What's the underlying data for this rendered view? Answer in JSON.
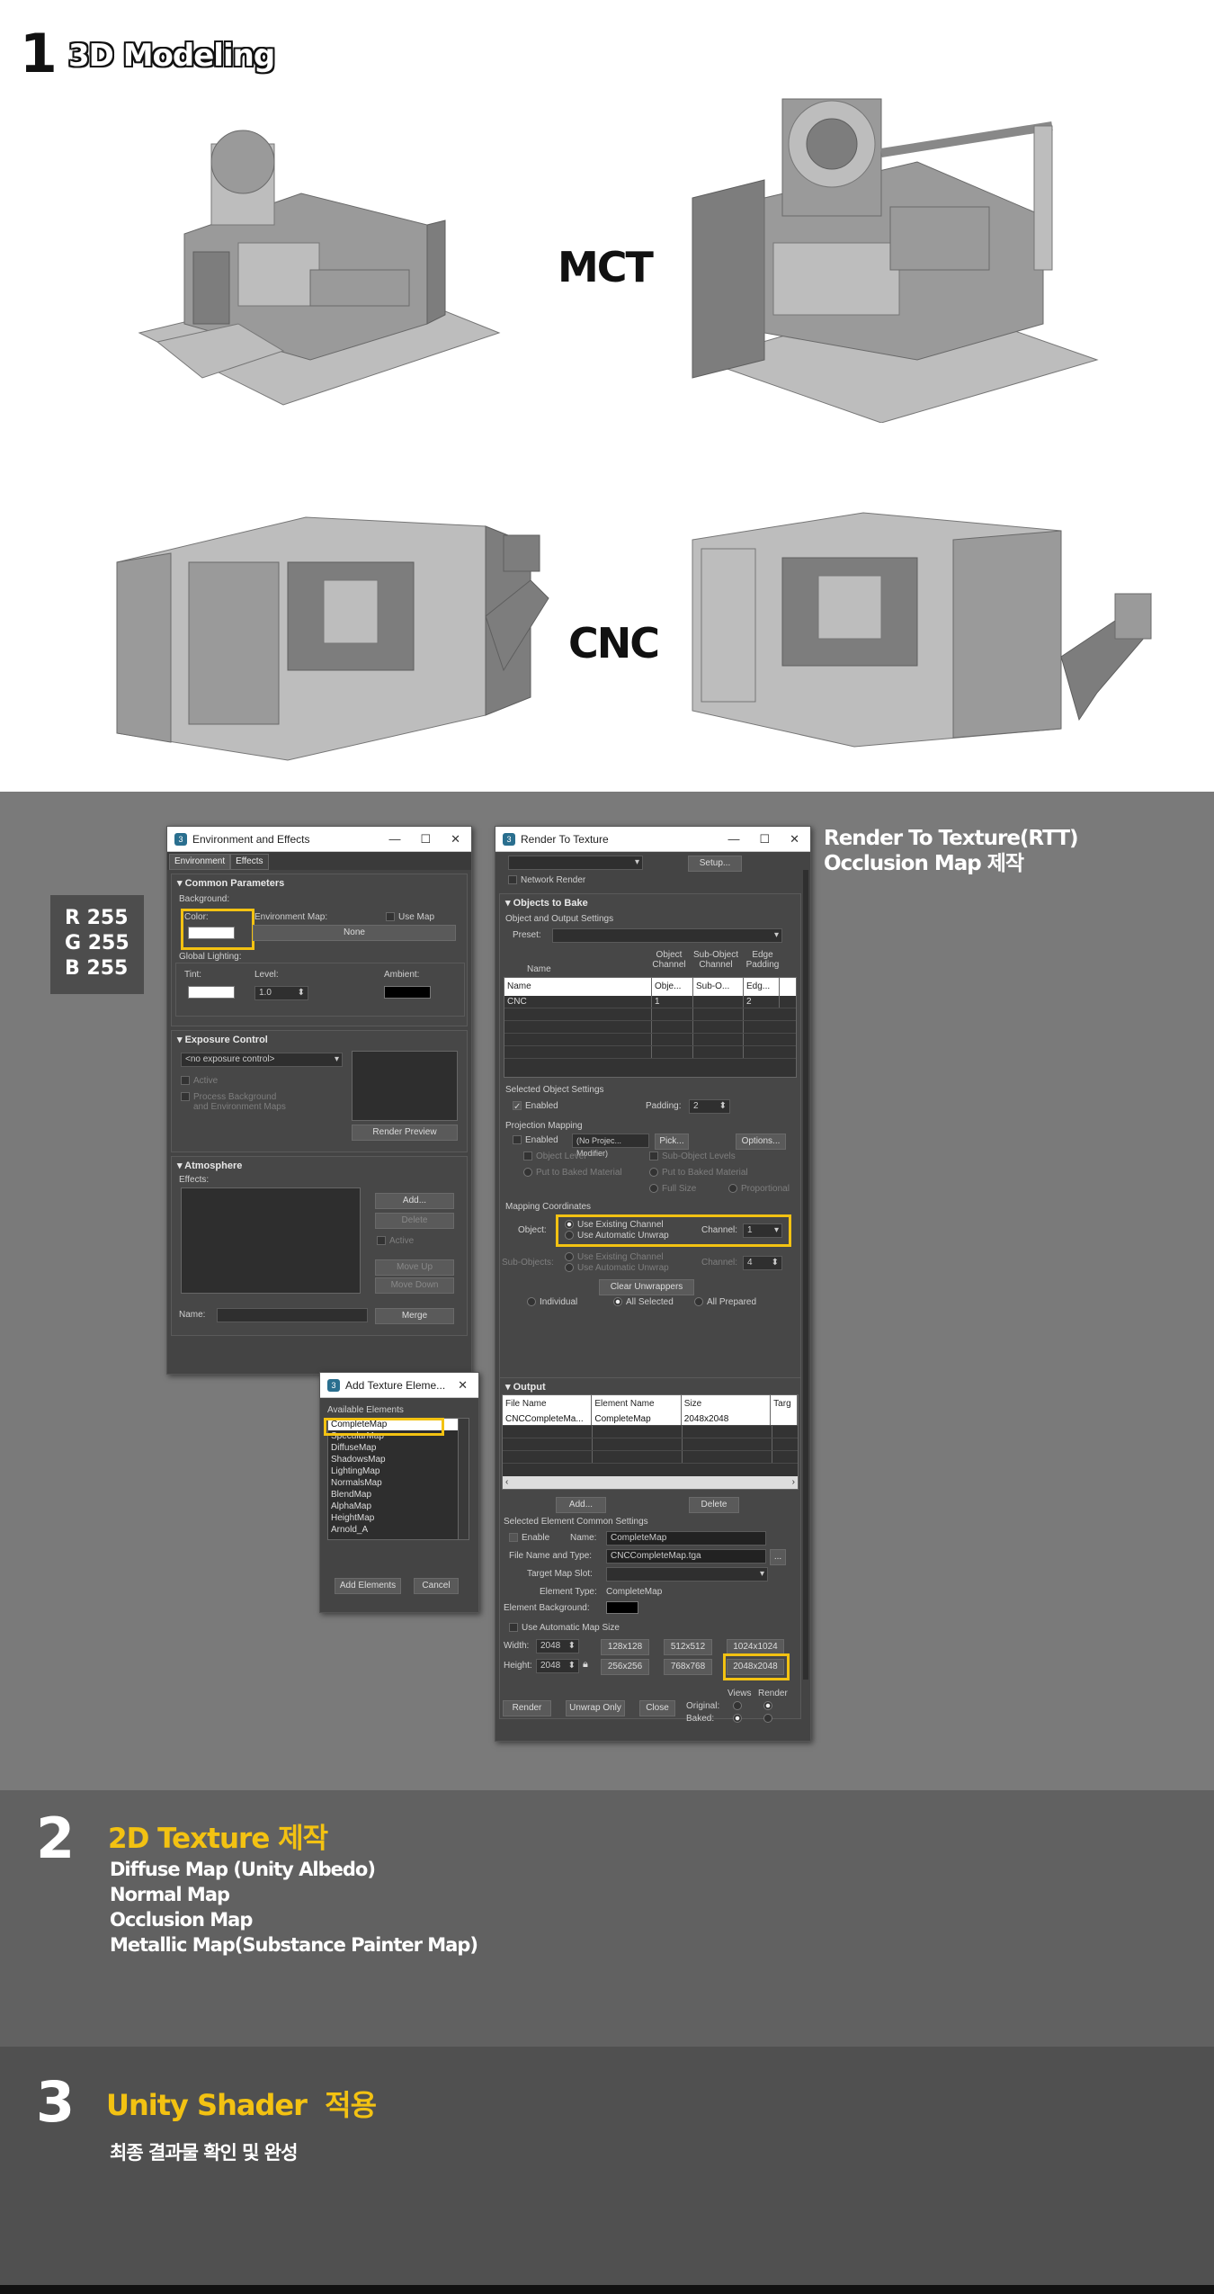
{
  "section1": {
    "number": "1",
    "title": "3D Modeling",
    "label_mct": "MCT",
    "label_cnc": "CNC"
  },
  "rgb_box": {
    "r": "R 255",
    "g": "G 255",
    "b": "B 255"
  },
  "rtt_caption": {
    "line1": "Render To Texture(RTT)",
    "line2": "Occlusion Map 제작"
  },
  "env_window": {
    "title": "Environment and Effects",
    "tabs": [
      "Environment",
      "Effects"
    ],
    "common_params": "Common Parameters",
    "background": "Background:",
    "color": "Color:",
    "env_map": "Environment Map:",
    "use_map": "Use Map",
    "none_btn": "None",
    "global_lighting": "Global Lighting:",
    "tint": "Tint:",
    "level": "Level:",
    "level_value": "1.0",
    "ambient": "Ambient:",
    "exposure_control": "Exposure Control",
    "no_exposure": "<no exposure control>",
    "active": "Active",
    "process_bg_1": "Process Background",
    "process_bg_2": "and Environment Maps",
    "render_preview": "Render Preview",
    "atmosphere": "Atmosphere",
    "effects": "Effects:",
    "add": "Add...",
    "delete": "Delete",
    "active2": "Active",
    "move_up": "Move Up",
    "move_down": "Move Down",
    "name": "Name:",
    "merge": "Merge"
  },
  "add_tex_window": {
    "title": "Add Texture Eleme...",
    "available": "Available Elements",
    "items": [
      "CompleteMap",
      "SpecularMap",
      "DiffuseMap",
      "ShadowsMap",
      "LightingMap",
      "NormalsMap",
      "BlendMap",
      "AlphaMap",
      "HeightMap",
      "Arnold_A"
    ],
    "add_elements": "Add Elements",
    "cancel": "Cancel"
  },
  "rtt_window": {
    "title": "Render To Texture",
    "setup": "Setup...",
    "network_render": "Network Render",
    "objects_to_bake": "Objects to Bake",
    "obj_output_settings": "Object and Output Settings",
    "preset": "Preset:",
    "col_headers": {
      "name": "Name",
      "obj_channel": "Object Channel",
      "subobj_channel": "Sub-Object Channel",
      "edge_padding": "Edge Padding"
    },
    "table_header": [
      "Name",
      "Obje...",
      "Sub-O...",
      "Edg..."
    ],
    "table_rows": [
      [
        "CNC",
        "1",
        "",
        "2"
      ]
    ],
    "selected_obj_settings": "Selected Object Settings",
    "enabled": "Enabled",
    "padding": "Padding:",
    "padding_value": "2",
    "projection_mapping": "Projection Mapping",
    "proj_enabled": "Enabled",
    "no_projection": "(No Projec... Modifier)",
    "pick": "Pick...",
    "options": "Options...",
    "object_level": "Object Level",
    "sub_object_levels": "Sub-Object Levels",
    "put_baked": "Put to Baked Material",
    "put_baked2": "Put to Baked Material",
    "full_size": "Full Size",
    "proportional": "Proportional",
    "mapping_coords": "Mapping Coordinates",
    "object": "Object:",
    "use_existing": "Use Existing Channel",
    "use_auto": "Use Automatic Unwrap",
    "channel": "Channel:",
    "channel_value": "1",
    "sub_objects": "Sub-Objects:",
    "sub_use_existing": "Use Existing Channel",
    "sub_use_auto": "Use Automatic Unwrap",
    "sub_channel": "Channel:",
    "sub_channel_value": "4",
    "clear_unwrappers": "Clear Unwrappers",
    "individual": "Individual",
    "all_selected": "All Selected",
    "all_prepared": "All Prepared",
    "output": "Output",
    "out_headers": [
      "File Name",
      "Element Name",
      "Size",
      "Targ"
    ],
    "out_rows": [
      [
        "CNCCompleteMa...",
        "CompleteMap",
        "2048x2048",
        ""
      ]
    ],
    "add": "Add...",
    "delete": "Delete",
    "sel_elem_settings": "Selected Element Common Settings",
    "enable": "Enable",
    "name_lbl": "Name:",
    "name_value": "CompleteMap",
    "file_name_type": "File Name and Type:",
    "file_value": "CNCCompleteMap.tga",
    "browse": "...",
    "target_map_slot": "Target Map Slot:",
    "element_type_lbl": "Element Type:",
    "element_type": "CompleteMap",
    "element_bg": "Element Background:",
    "use_auto_size": "Use Automatic Map Size",
    "width": "Width:",
    "width_value": "2048",
    "height": "Height:",
    "height_value": "2048",
    "sizes_row1": [
      "128x128",
      "512x512",
      "1024x1024"
    ],
    "sizes_row2": [
      "256x256",
      "768x768",
      "2048x2048"
    ],
    "render": "Render",
    "unwrap_only": "Unwrap Only",
    "close": "Close",
    "views": "Views",
    "render_lbl": "Render",
    "original": "Original:",
    "baked": "Baked:"
  },
  "section2": {
    "number": "2",
    "title": "2D Texture 제작",
    "items": [
      "Diffuse Map (Unity Albedo)",
      "Normal Map",
      "Occlusion Map",
      "Metallic Map(Substance Painter Map)"
    ]
  },
  "section3": {
    "number": "3",
    "title": "Unity Shader  적용",
    "subtitle": "최종 결과물 확인 및 완성"
  },
  "colors": {
    "accent": "#f3c212",
    "panel_bg": "#444444",
    "section2_bg": "#7a7a7a"
  }
}
